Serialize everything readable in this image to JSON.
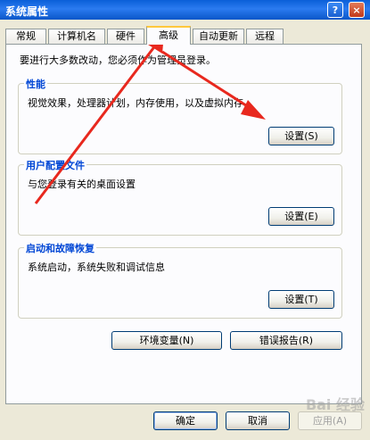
{
  "window": {
    "title": "系统属性",
    "help_label": "?",
    "close_label": "×"
  },
  "tabs": [
    {
      "label": "常规"
    },
    {
      "label": "计算机名"
    },
    {
      "label": "硬件"
    },
    {
      "label": "高级"
    },
    {
      "label": "自动更新"
    },
    {
      "label": "远程"
    }
  ],
  "intro": "要进行大多数改动，您必须作为管理员登录。",
  "groups": {
    "performance": {
      "legend": "性能",
      "description": "视觉效果，处理器计划，内存使用，以及虚拟内存",
      "button": "设置(S)"
    },
    "profiles": {
      "legend": "用户配置文件",
      "description": "与您登录有关的桌面设置",
      "button": "设置(E)"
    },
    "startup": {
      "legend": "启动和故障恢复",
      "description": "系统启动，系统失败和调试信息",
      "button": "设置(T)"
    }
  },
  "buttons": {
    "env_vars": "环境变量(N)",
    "error_report": "错误报告(R)",
    "ok": "确定",
    "cancel": "取消",
    "apply": "应用(A)"
  },
  "watermark": "Bai 经验",
  "colors": {
    "annotation_arrow": "#E8281E",
    "legend_text": "#0046D5"
  }
}
